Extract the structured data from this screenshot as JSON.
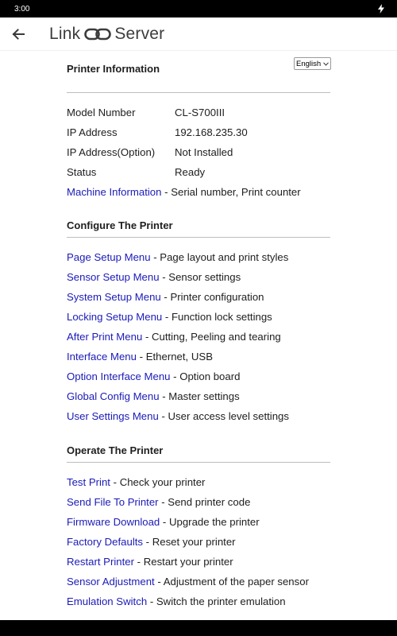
{
  "status_bar": {
    "time": "3:00"
  },
  "app_bar": {
    "title_left": "Link",
    "title_right": "Server"
  },
  "language_select": {
    "value": "English"
  },
  "printer_info": {
    "title": "Printer Information",
    "rows": [
      {
        "key": "Model Number",
        "value": "CL-S700III"
      },
      {
        "key": "IP Address",
        "value": "192.168.235.30"
      },
      {
        "key": "IP Address(Option)",
        "value": "Not Installed"
      },
      {
        "key": "Status",
        "value": "Ready"
      }
    ],
    "machine_link": "Machine Information",
    "machine_desc": " - Serial number, Print counter"
  },
  "configure": {
    "title": "Configure The Printer",
    "items": [
      {
        "link": "Page Setup Menu",
        "desc": " - Page layout and print styles"
      },
      {
        "link": "Sensor Setup Menu",
        "desc": " - Sensor settings"
      },
      {
        "link": "System Setup Menu",
        "desc": " - Printer configuration"
      },
      {
        "link": "Locking Setup Menu",
        "desc": " - Function lock settings"
      },
      {
        "link": "After Print Menu",
        "desc": " - Cutting, Peeling and tearing"
      },
      {
        "link": "Interface Menu",
        "desc": " - Ethernet, USB"
      },
      {
        "link": "Option Interface Menu",
        "desc": " - Option board"
      },
      {
        "link": "Global Config Menu",
        "desc": " - Master settings"
      },
      {
        "link": "User Settings Menu",
        "desc": " - User access level settings"
      }
    ]
  },
  "operate": {
    "title": "Operate The Printer",
    "items": [
      {
        "link": "Test Print",
        "desc": " - Check your printer"
      },
      {
        "link": "Send File To Printer",
        "desc": " - Send printer code"
      },
      {
        "link": "Firmware Download",
        "desc": " - Upgrade the printer"
      },
      {
        "link": "Factory Defaults",
        "desc": " - Reset your printer"
      },
      {
        "link": "Restart Printer",
        "desc": " - Restart your printer"
      },
      {
        "link": "Sensor Adjustment",
        "desc": " - Adjustment of the paper sensor"
      },
      {
        "link": "Emulation Switch",
        "desc": " - Switch the printer emulation"
      }
    ]
  },
  "colors": {
    "link": "#1b1bb8",
    "divider": "#bdbdbd",
    "status_bar": "#000000"
  }
}
